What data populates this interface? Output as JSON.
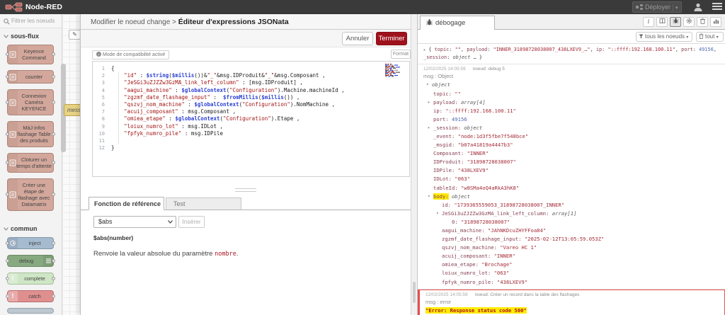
{
  "header": {
    "brand": "Node-RED",
    "deploy": "Déployer"
  },
  "palette": {
    "filter_placeholder": "Filtrer les noeuds",
    "sections": [
      {
        "label": "sous-flux",
        "nodes": [
          {
            "label": "Keyence Command",
            "type": "subflow",
            "color": "#d3a79b",
            "border": "#ad8578"
          },
          {
            "label": "counter",
            "type": "subflow",
            "color": "#d3a79b",
            "border": "#ad8578"
          },
          {
            "label": "Connexion Caméra KEYENCE",
            "type": "subflow",
            "color": "#d3a79b",
            "border": "#ad8578"
          },
          {
            "label": "MàJ infos flashage Table des produits",
            "type": "subflow",
            "color": "#d3a79b",
            "border": "#ad8578"
          },
          {
            "label": "Cloturer un temps d'attente",
            "type": "subflow",
            "color": "#d3a79b",
            "border": "#ad8578"
          },
          {
            "label": "Créer une étape de flashage avec Datamatrix",
            "type": "subflow",
            "color": "#d3a79b",
            "border": "#ad8578"
          }
        ]
      },
      {
        "label": "commun",
        "nodes": [
          {
            "label": "inject",
            "type": "inject",
            "color": "#a6bbcf",
            "border": "#8096a8"
          },
          {
            "label": "debug",
            "type": "debug",
            "color": "#87a980",
            "border": "#6a8a61"
          },
          {
            "label": "complete",
            "type": "complete",
            "color": "#cfe6c6",
            "border": "#a3bf98"
          },
          {
            "label": "catch",
            "type": "catch",
            "color": "#e08f8f",
            "border": "#bb6d6d"
          },
          {
            "label": "",
            "type": "status",
            "color": "#bdc7cf",
            "border": "#93a1ad"
          }
        ]
      }
    ]
  },
  "workspace": {
    "partial_node_label": "mess"
  },
  "tray": {
    "breadcrumb": "Modifier le noeud change",
    "separator": " > ",
    "title": "Éditeur d'expressions JSONata",
    "cancel": "Annuler",
    "done": "Terminer",
    "compat_notice": "Mode de compatibilité activé",
    "format": "Format",
    "code_lines": [
      {
        "no": "1",
        "tokens": [
          [
            "p",
            "{"
          ]
        ]
      },
      {
        "no": "2",
        "tokens": [
          [
            "p",
            "\t"
          ],
          [
            "s",
            "\"id\""
          ],
          [
            "p",
            " : "
          ],
          [
            "f",
            "$string"
          ],
          [
            "p",
            "("
          ],
          [
            "f",
            "$millis"
          ],
          [
            "p",
            "())&"
          ],
          [
            "s",
            "\"_\""
          ],
          [
            "p",
            "&msg.IDProduit&"
          ],
          [
            "s",
            "\"_\""
          ],
          [
            "p",
            "&msg.Composant ,"
          ]
        ]
      },
      {
        "no": "3",
        "tokens": [
          [
            "p",
            "\t"
          ],
          [
            "s",
            "\"JeSGi3uZJZZw3GzMA_link_left_column\""
          ],
          [
            "p",
            " : [msg.IDProduit] ,"
          ]
        ]
      },
      {
        "no": "4",
        "tokens": [
          [
            "p",
            "\t"
          ],
          [
            "s",
            "\"aagui_machine\""
          ],
          [
            "p",
            " : "
          ],
          [
            "f",
            "$globalContext"
          ],
          [
            "p",
            "("
          ],
          [
            "s",
            "\"Configuration\""
          ],
          [
            "p",
            ").Machine.machineId ,"
          ]
        ]
      },
      {
        "no": "5",
        "tokens": [
          [
            "p",
            "\t"
          ],
          [
            "s",
            "\"zgzmf_date_flashage_input\""
          ],
          [
            "p",
            " :  "
          ],
          [
            "f",
            "$fromMillis"
          ],
          [
            "p",
            "("
          ],
          [
            "f",
            "$millis"
          ],
          [
            "p",
            "()) ,"
          ]
        ]
      },
      {
        "no": "6",
        "tokens": [
          [
            "p",
            "\t"
          ],
          [
            "s",
            "\"qszvj_nom_machine\""
          ],
          [
            "p",
            " : "
          ],
          [
            "f",
            "$globalContext"
          ],
          [
            "p",
            "("
          ],
          [
            "s",
            "\"Configuration\""
          ],
          [
            "p",
            ").NomMachine ,"
          ]
        ]
      },
      {
        "no": "7",
        "tokens": [
          [
            "p",
            "\t"
          ],
          [
            "s",
            "\"acuij_composant\""
          ],
          [
            "p",
            " : msg.Composant ,"
          ]
        ]
      },
      {
        "no": "8",
        "tokens": [
          [
            "p",
            "\t"
          ],
          [
            "s",
            "\"omiea_etape\""
          ],
          [
            "p",
            " : "
          ],
          [
            "f",
            "$globalContext"
          ],
          [
            "p",
            "("
          ],
          [
            "s",
            "\"Configuration\""
          ],
          [
            "p",
            ").Etape ,"
          ]
        ]
      },
      {
        "no": "9",
        "tokens": [
          [
            "p",
            "\t"
          ],
          [
            "s",
            "\"loiux_numro_lot\""
          ],
          [
            "p",
            " : msg.IDLot ,"
          ]
        ]
      },
      {
        "no": "10",
        "tokens": [
          [
            "p",
            "\t"
          ],
          [
            "s",
            "\"fpfyk_numro_pile\""
          ],
          [
            "p",
            " : msg.IDPile"
          ]
        ]
      },
      {
        "no": "11",
        "tokens": []
      },
      {
        "no": "12",
        "tokens": [
          [
            "p",
            "}"
          ]
        ]
      }
    ],
    "tabs": {
      "reference": "Fonction de référence",
      "test": "Test"
    },
    "function_select": "$abs",
    "insert": "Insérer",
    "signature": "$abs(number)",
    "description_prefix": "Renvoie la valeur absolue du paramètre ",
    "description_arg": "nombre",
    "description_suffix": "."
  },
  "debug": {
    "tab": "débogage",
    "filter_button": "tous les noeuds",
    "clear_button": "tout",
    "messages": [
      {
        "kind": "preview",
        "tokens": [
          [
            "p",
            "{ "
          ],
          [
            "k",
            "topic"
          ],
          [
            "p",
            ": "
          ],
          [
            "s",
            "\"\""
          ],
          [
            "p",
            ", "
          ],
          [
            "k",
            "payload"
          ],
          [
            "p",
            ": "
          ],
          [
            "s",
            "\"INNER_31898728038007_438LXEV9_…\""
          ],
          [
            "p",
            ", "
          ],
          [
            "k",
            "ip"
          ],
          [
            "p",
            ": "
          ],
          [
            "s",
            "\"::ffff:192.168.100.11\""
          ],
          [
            "p",
            ", "
          ],
          [
            "k",
            "port"
          ],
          [
            "p",
            ": "
          ],
          [
            "n",
            "49156"
          ],
          [
            "p",
            ", "
          ],
          [
            "k",
            "_session"
          ],
          [
            "p",
            ": "
          ],
          [
            "t",
            "object"
          ],
          [
            "p",
            " … }"
          ]
        ]
      },
      {
        "kind": "tree",
        "date": "12/02/2025 14:05:59",
        "node": "noeud: debug 5",
        "msg_label": "msg : Object",
        "rows": [
          {
            "i": 0,
            "a": "v",
            "v": "object",
            "vt": "t"
          },
          {
            "i": 1,
            "k": "topic",
            "v": "\"\"",
            "vt": "s"
          },
          {
            "i": 1,
            "a": "r",
            "k": "payload",
            "v": "array[4]",
            "vt": "t"
          },
          {
            "i": 1,
            "k": "ip",
            "v": "\"::ffff:192.168.100.11\"",
            "vt": "s"
          },
          {
            "i": 1,
            "k": "port",
            "v": "49156",
            "vt": "n"
          },
          {
            "i": 1,
            "a": "r",
            "k": "_session",
            "v": "object",
            "vt": "t"
          },
          {
            "i": 1,
            "k": "_event",
            "v": "\"node:1d3f5fbe7f548bce\"",
            "vt": "s"
          },
          {
            "i": 1,
            "k": "_msgid",
            "v": "\"b07a41819a4447b3\"",
            "vt": "s"
          },
          {
            "i": 1,
            "k": "Composant",
            "v": "\"INNER\"",
            "vt": "s"
          },
          {
            "i": 1,
            "k": "IDProduit",
            "v": "\"31898728038007\"",
            "vt": "s"
          },
          {
            "i": 1,
            "k": "IDPile",
            "v": "\"438LXEV9\"",
            "vt": "s"
          },
          {
            "i": 1,
            "k": "IDLot",
            "v": "\"063\"",
            "vt": "s"
          },
          {
            "i": 1,
            "k": "tableId",
            "v": "\"w8SMa4oQ4aRkA3hK8\"",
            "vt": "s"
          },
          {
            "i": 1,
            "a": "v",
            "k": "body",
            "v": "object",
            "vt": "t",
            "hl": true
          },
          {
            "i": 2,
            "k": "id",
            "v": "\"1739365559053_31898728038007_INNER\"",
            "vt": "s"
          },
          {
            "i": 2,
            "a": "v",
            "k": "JeSGi3uZJZZw3GzMA_link_left_column",
            "v": "array[1]",
            "vt": "t"
          },
          {
            "i": 3,
            "k": "0",
            "v": "\"31898728038007\"",
            "vt": "s"
          },
          {
            "i": 2,
            "k": "aagui_machine",
            "v": "\"JAhNKDcuZHYFFoa84\"",
            "vt": "s"
          },
          {
            "i": 2,
            "k": "zgzmf_date_flashage_input",
            "v": "\"2025-02-12T13:05:59.053Z\"",
            "vt": "s"
          },
          {
            "i": 2,
            "k": "qszvj_nom_machine",
            "v": "\"Vareo HC 1\"",
            "vt": "s"
          },
          {
            "i": 2,
            "k": "acuij_composant",
            "v": "\"INNER\"",
            "vt": "s"
          },
          {
            "i": 2,
            "k": "omiea_etape",
            "v": "\"Brochage\"",
            "vt": "s"
          },
          {
            "i": 2,
            "k": "loiux_numro_lot",
            "v": "\"063\"",
            "vt": "s"
          },
          {
            "i": 2,
            "k": "fpfyk_numro_pile",
            "v": "\"438LXEV9\"",
            "vt": "s"
          }
        ]
      },
      {
        "kind": "error",
        "date": "12/02/2025 14:05:59",
        "node": "noeud: Créer un record dans la table des flashages",
        "msg_label": "msg : error",
        "content": "\"Error: Response status code 500\""
      }
    ]
  }
}
